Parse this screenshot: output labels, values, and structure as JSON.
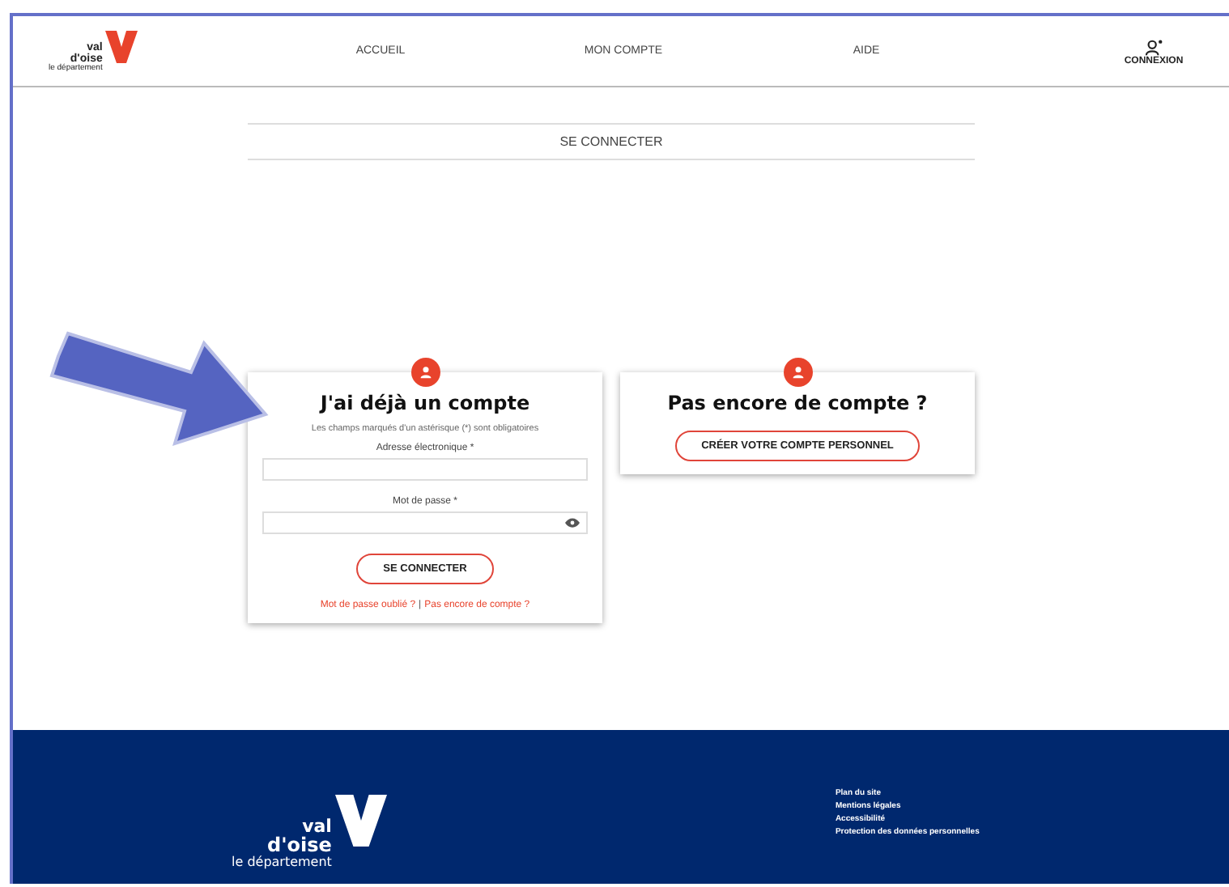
{
  "header": {
    "logo": {
      "line1": "val",
      "line2": "d'oise",
      "line3": "le département"
    },
    "nav": [
      {
        "label": "ACCUEIL"
      },
      {
        "label": "MON COMPTE"
      },
      {
        "label": "AIDE"
      }
    ],
    "account": {
      "label": "CONNEXION"
    }
  },
  "page_tab": {
    "label": "SE CONNECTER"
  },
  "login_card": {
    "title": "J'ai déjà un compte",
    "note": "Les champs marqués d'un astérisque (*) sont obligatoires",
    "fields": [
      {
        "label": "Adresse électronique *",
        "kind": "text"
      },
      {
        "label": "Mot de passe *",
        "kind": "password"
      }
    ],
    "button": "SE CONNECTER",
    "links": [
      {
        "label": "Mot de passe oublié ?"
      },
      {
        "label": "Pas encore de compte ?"
      }
    ],
    "separator": "|"
  },
  "signup_card": {
    "title": "Pas encore de compte ?",
    "button": "CRÉER VOTRE COMPTE PERSONNEL"
  },
  "footer": {
    "logo": {
      "line1": "val",
      "line2": "d'oise",
      "line3": "le département"
    },
    "links": [
      {
        "label": "Plan du site"
      },
      {
        "label": "Mentions légales"
      },
      {
        "label": "Accessibilité"
      },
      {
        "label": "Protection des données personnelles"
      }
    ]
  }
}
